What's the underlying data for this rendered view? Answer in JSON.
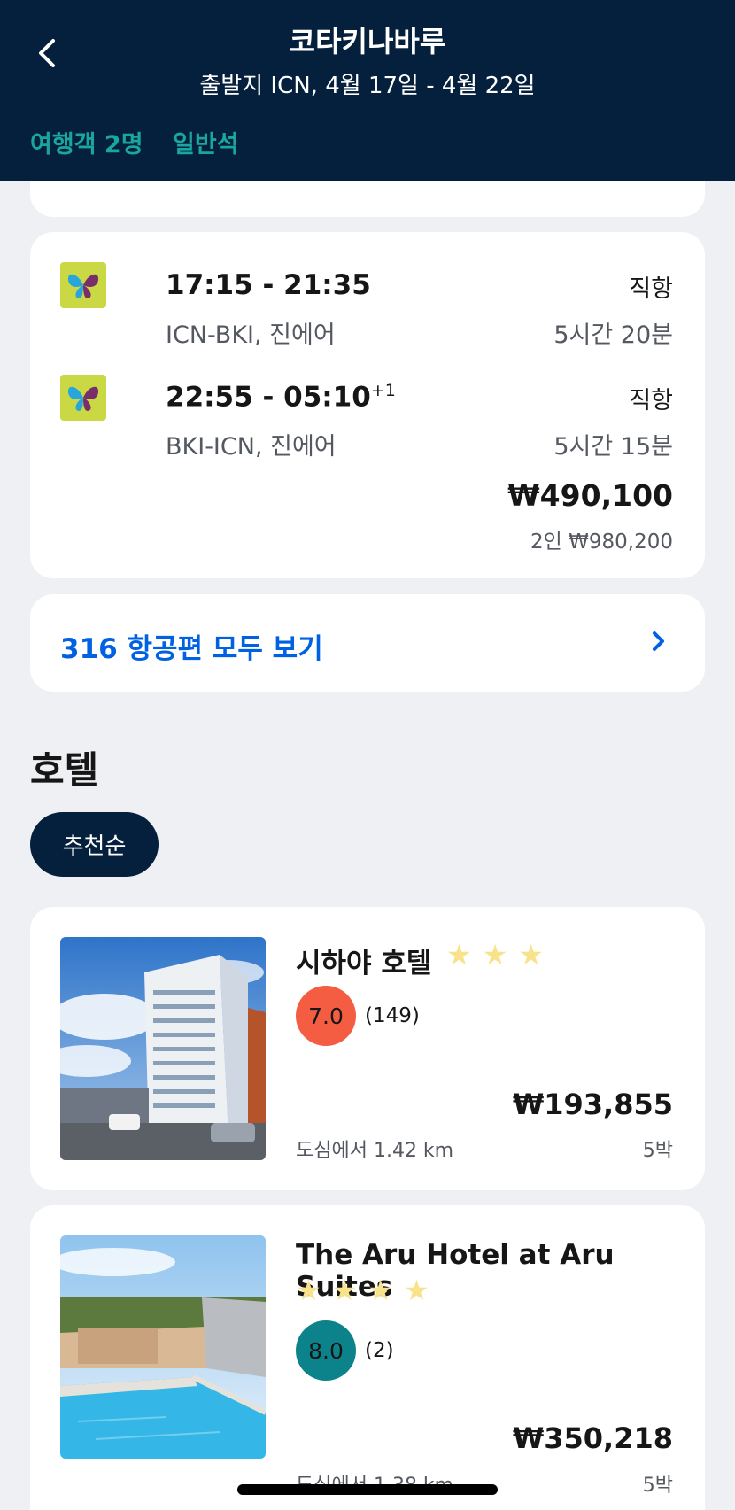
{
  "header": {
    "title": "코타키나바루",
    "subtitle": "출발지 ICN, 4월 17일 - 4월 22일",
    "travelers": "여행객 2명",
    "cabin": "일반석"
  },
  "flight_card": {
    "outbound": {
      "times": "17:15 - 21:35",
      "route": "ICN-BKI, 진에어",
      "stops": "직항",
      "duration": "5시간 20분"
    },
    "inbound": {
      "times": "22:55 - 05:10",
      "day_offset": "+1",
      "route": "BKI-ICN, 진에어",
      "stops": "직항",
      "duration": "5시간 15분"
    },
    "price": "₩490,100",
    "total_price": "2인 ₩980,200"
  },
  "see_all": {
    "label": "316 항공편 모두 보기"
  },
  "hotels_section": {
    "title": "호텔",
    "sort_chip": "추천순",
    "hotels": [
      {
        "name": "시하야 호텔",
        "stars": 3,
        "score": "7.0",
        "score_color": "#f55d42",
        "reviews": "(149)",
        "price": "₩193,855",
        "distance": "도심에서 1.42 km",
        "nights": "5박"
      },
      {
        "name": "The Aru Hotel at Aru Suites",
        "stars": 4,
        "score": "8.0",
        "score_color": "#0c838a",
        "reviews": "(2)",
        "price": "₩350,218",
        "distance": "도심에서 1.38 km",
        "nights": "5박"
      }
    ]
  },
  "colors": {
    "header_bg": "#05203c",
    "accent_teal": "#1aa6a0",
    "link_blue": "#0062e3",
    "star": "#f8e38c"
  },
  "icons": {
    "back": "chevron-left-icon",
    "see_all_arrow": "chevron-right-icon",
    "airline": "jinair-butterfly-logo",
    "star": "star-icon"
  }
}
